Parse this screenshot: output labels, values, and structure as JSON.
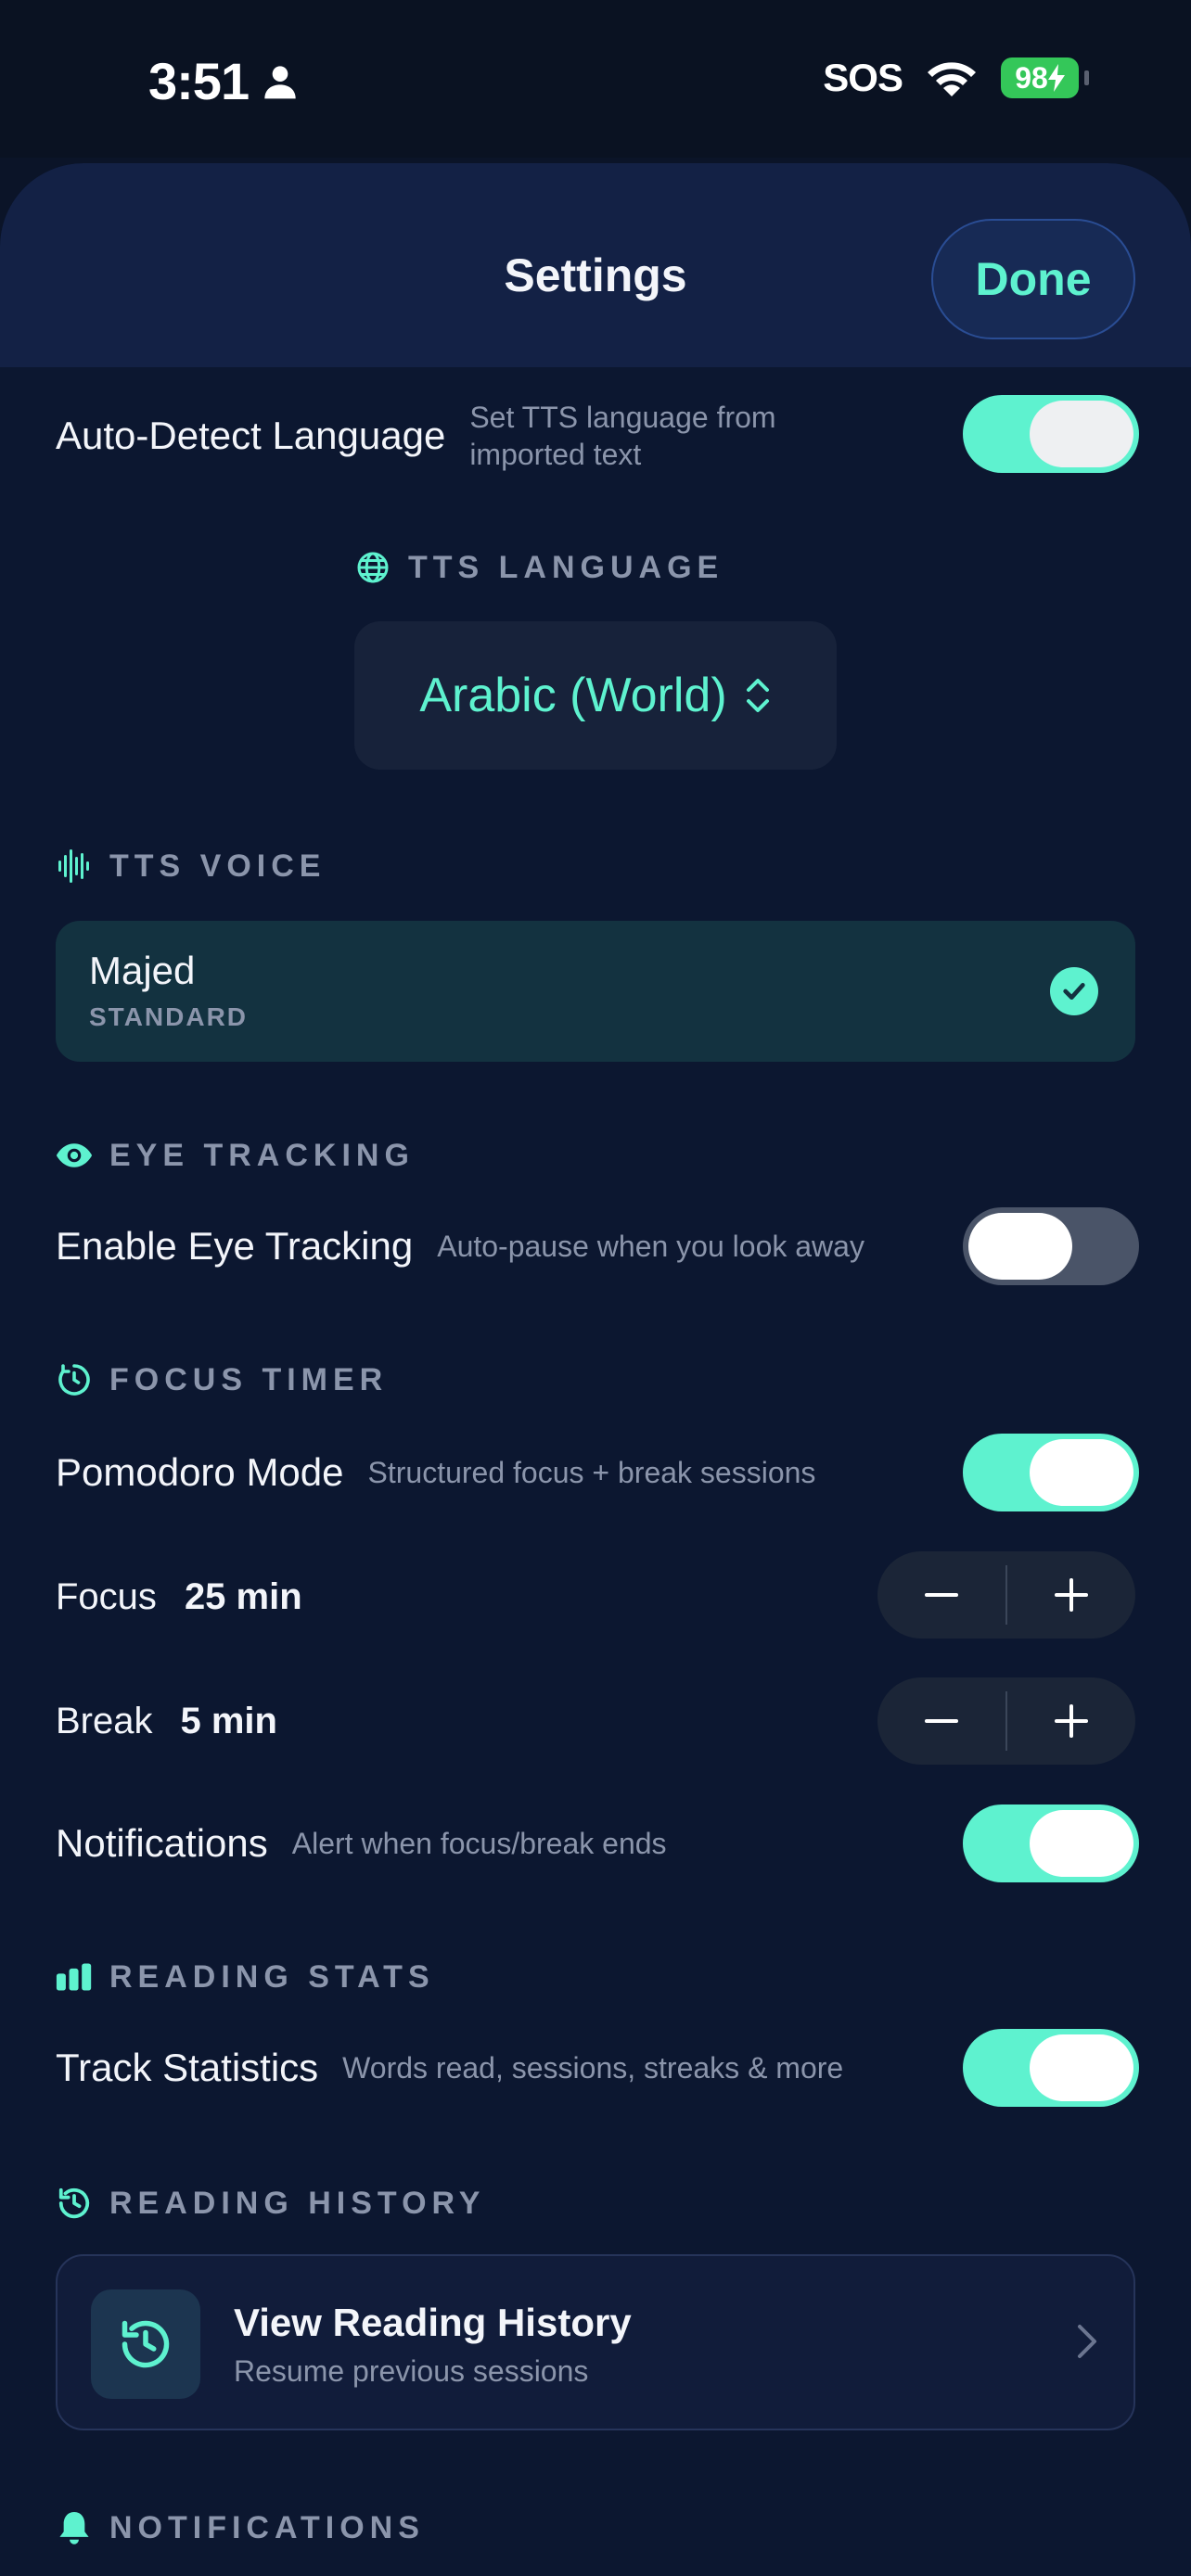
{
  "status_bar": {
    "time": "3:51",
    "carrier": "SOS",
    "battery": "98"
  },
  "header": {
    "title": "Settings",
    "done_label": "Done"
  },
  "auto_detect": {
    "title": "Auto-Detect Language",
    "subtitle": "Set TTS language from imported text",
    "enabled": true
  },
  "tts_language": {
    "section": "TTS LANGUAGE",
    "value": "Arabic (World)"
  },
  "tts_voice": {
    "section": "TTS VOICE",
    "name": "Majed",
    "type": "STANDARD",
    "selected": true
  },
  "eye_tracking": {
    "section": "EYE TRACKING",
    "title": "Enable Eye Tracking",
    "subtitle": "Auto-pause when you look away",
    "enabled": false
  },
  "focus_timer": {
    "section": "FOCUS TIMER",
    "pomodoro_title": "Pomodoro Mode",
    "pomodoro_subtitle": "Structured focus + break sessions",
    "pomodoro_enabled": true,
    "focus_label": "Focus",
    "focus_value": "25 min",
    "break_label": "Break",
    "break_value": "5 min",
    "notifications_title": "Notifications",
    "notifications_subtitle": "Alert when focus/break ends",
    "notifications_enabled": true
  },
  "reading_stats": {
    "section": "READING STATS",
    "title": "Track Statistics",
    "subtitle": "Words read, sessions, streaks & more",
    "enabled": true
  },
  "reading_history": {
    "section": "READING HISTORY",
    "title": "View Reading History",
    "subtitle": "Resume previous sessions"
  },
  "notifications": {
    "section": "NOTIFICATIONS"
  },
  "colors": {
    "accent": "#5ef2cf",
    "background": "#0c1730",
    "muted_text": "#8b95ab"
  }
}
